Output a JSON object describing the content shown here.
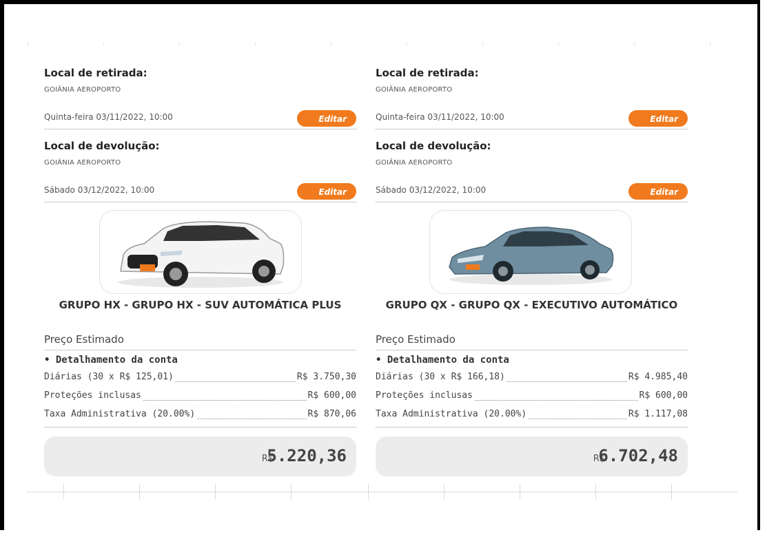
{
  "colors": {
    "accent": "#f07a1d",
    "total_bg": "#ececec"
  },
  "offers": [
    {
      "pickup_title": "Local de retirada:",
      "pickup_place": "GOIÂNIA AEROPORTO",
      "pickup_date": "Quinta-feira 03/11/2022, 10:00",
      "edit_label": "Editar",
      "return_title": "Local de devolução:",
      "return_place": "GOIÂNIA AEROPORTO",
      "return_date": "Sábado 03/12/2022, 10:00",
      "car_image": "white-suv-car-image",
      "car_name": "GRUPO HX - GRUPO HX - SUV AUTOMÁTICA PLUS",
      "price_label": "Preço Estimado",
      "detail_title": "• Detalhamento da conta",
      "lines": [
        {
          "label": "Diárias (30 x R$ 125,01)",
          "amount": "R$ 3.750,30"
        },
        {
          "label": "Proteções inclusas",
          "amount": "R$ 600,00"
        },
        {
          "label": "Taxa Administrativa (20.00%)",
          "amount": "R$ 870,06"
        }
      ],
      "total_currency": "R$",
      "total_value": "5.220,36"
    },
    {
      "pickup_title": "Local de retirada:",
      "pickup_place": "GOIÂNIA AEROPORTO",
      "pickup_date": "Quinta-feira 03/11/2022, 10:00",
      "edit_label": "Editar",
      "return_title": "Local de devolução:",
      "return_place": "GOIÂNIA AEROPORTO",
      "return_date": "Sábado 03/12/2022, 10:00",
      "car_image": "blue-sedan-car-image",
      "car_name": "GRUPO QX - GRUPO QX - EXECUTIVO AUTOMÁTICO",
      "price_label": "Preço Estimado",
      "detail_title": "• Detalhamento da conta",
      "lines": [
        {
          "label": "Diárias (30 x R$ 166,18)",
          "amount": "R$ 4.985,40"
        },
        {
          "label": "Proteções inclusas",
          "amount": "R$ 600,00"
        },
        {
          "label": "Taxa Administrativa (20.00%)",
          "amount": "R$ 1.117,08"
        }
      ],
      "total_currency": "R$",
      "total_value": "6.702,48"
    }
  ]
}
